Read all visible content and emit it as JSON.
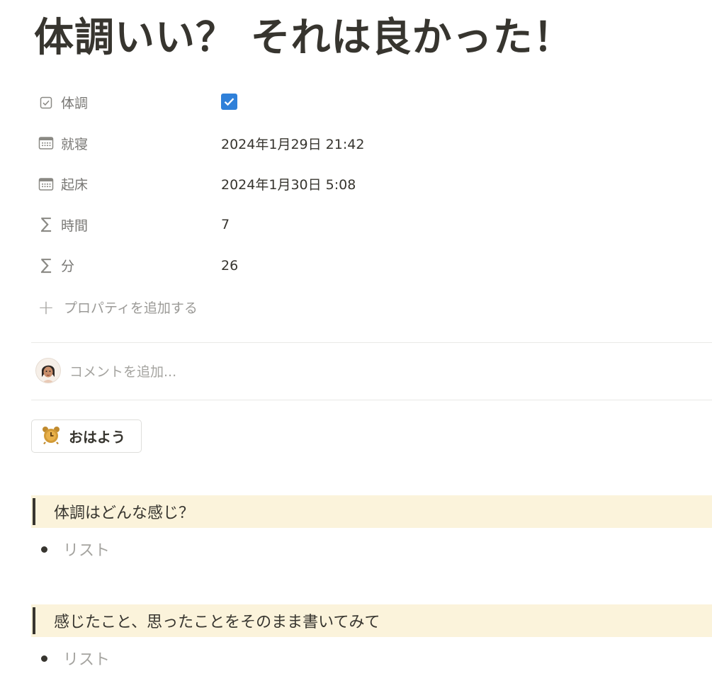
{
  "page": {
    "title": "体調いい？ それは良かった！"
  },
  "properties": [
    {
      "icon": "checkbox-property-icon",
      "name": "体調",
      "type": "checkbox",
      "checked": true,
      "value": ""
    },
    {
      "icon": "calendar-icon",
      "name": "就寝",
      "type": "date",
      "value": "2024年1月29日 21:42"
    },
    {
      "icon": "calendar-icon",
      "name": "起床",
      "type": "date",
      "value": "2024年1月30日 5:08"
    },
    {
      "icon": "sigma-icon",
      "name": "時間",
      "type": "formula",
      "value": "7"
    },
    {
      "icon": "sigma-icon",
      "name": "分",
      "type": "formula",
      "value": "26"
    }
  ],
  "add_property": {
    "label": "プロパティを追加する"
  },
  "comment": {
    "placeholder": "コメントを追加..."
  },
  "button": {
    "label": "おはよう",
    "icon": "alarm-clock-icon"
  },
  "sections": [
    {
      "heading": "体調はどんな感じ？",
      "bullet": "リスト"
    },
    {
      "heading": "感じたこと、思ったことをそのまま書いてみて",
      "bullet": "リスト"
    }
  ],
  "colors": {
    "text": "#37352f",
    "muted": "#787774",
    "checkbox": "#2f80d9",
    "callout_bg": "#fbf3db"
  }
}
